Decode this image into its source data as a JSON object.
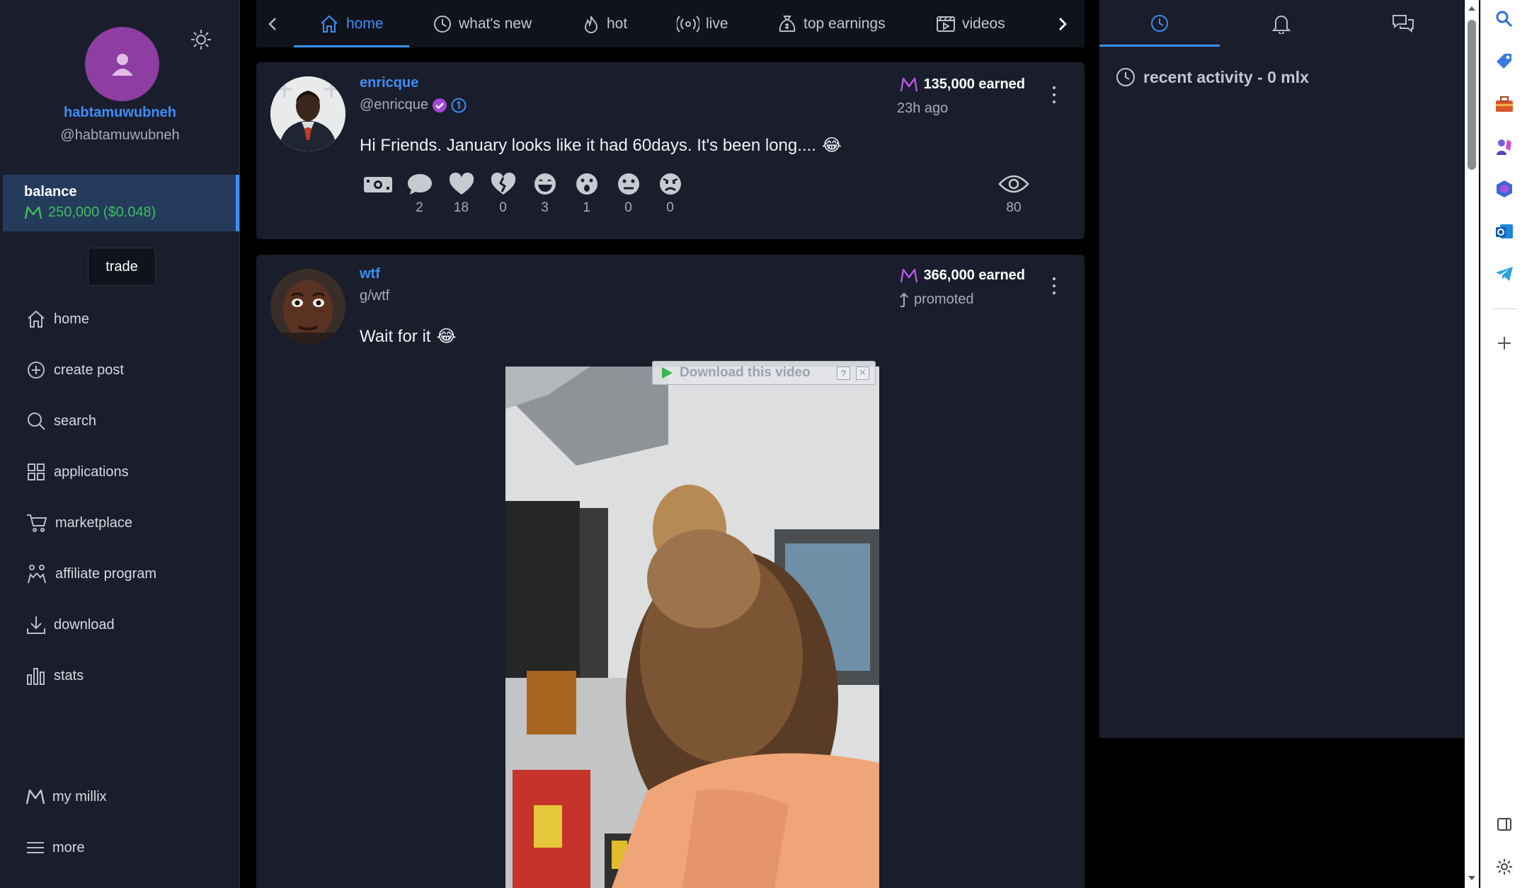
{
  "profile": {
    "username": "habtamuwubneh",
    "handle": "@habtamuwubneh"
  },
  "balance": {
    "label": "balance",
    "value": "250,000 ($0.048)"
  },
  "trade_label": "trade",
  "nav": [
    {
      "label": "home",
      "icon": "home-icon"
    },
    {
      "label": "create post",
      "icon": "plus-circle-icon"
    },
    {
      "label": "search",
      "icon": "search-icon"
    },
    {
      "label": "applications",
      "icon": "grid-icon"
    },
    {
      "label": "marketplace",
      "icon": "cart-icon"
    },
    {
      "label": "affiliate program",
      "icon": "people-icon"
    },
    {
      "label": "download",
      "icon": "download-icon"
    },
    {
      "label": "stats",
      "icon": "bar-chart-icon"
    },
    {
      "label": "my millix",
      "icon": "millix-icon"
    },
    {
      "label": "more",
      "icon": "menu-icon"
    }
  ],
  "tabs": [
    {
      "label": "home",
      "icon": "home-icon",
      "active": true
    },
    {
      "label": "what's new",
      "icon": "clock-icon"
    },
    {
      "label": "hot",
      "icon": "flame-icon"
    },
    {
      "label": "live",
      "icon": "broadcast-icon"
    },
    {
      "label": "top earnings",
      "icon": "money-bag-icon"
    },
    {
      "label": "videos",
      "icon": "video-icon"
    }
  ],
  "posts": [
    {
      "author": "enricque",
      "sub": "@enricque",
      "earned": "135,000 earned",
      "meta": "23h ago",
      "text": "Hi Friends. January looks like it had 60days. It's been long....",
      "emoji": "😂",
      "reactions": [
        {
          "icon": "money-icon",
          "count": ""
        },
        {
          "icon": "comment-icon",
          "count": "2"
        },
        {
          "icon": "heart-icon",
          "count": "18"
        },
        {
          "icon": "broken-heart-icon",
          "count": "0"
        },
        {
          "icon": "laugh-icon",
          "count": "3"
        },
        {
          "icon": "surprised-icon",
          "count": "1"
        },
        {
          "icon": "neutral-icon",
          "count": "0"
        },
        {
          "icon": "angry-icon",
          "count": "0"
        }
      ],
      "views": "80"
    },
    {
      "author": "wtf",
      "sub": "g/wtf",
      "earned": "366,000 earned",
      "meta": "promoted",
      "text": "Wait for it",
      "emoji": "😂",
      "download_label": "Download this video"
    }
  ],
  "right_panel": {
    "tabs": [
      "clock-icon",
      "bell-icon",
      "chat-icon"
    ],
    "recent": "recent activity - 0 mlx"
  },
  "colors": {
    "accent": "#3d8ef6",
    "sidebar_bg": "#1a1d2b",
    "page_bg": "#11131c",
    "balance_green": "#3dbd5d",
    "avatar_purple": "#8e3da3",
    "millix_purple": "#b45ae8"
  }
}
